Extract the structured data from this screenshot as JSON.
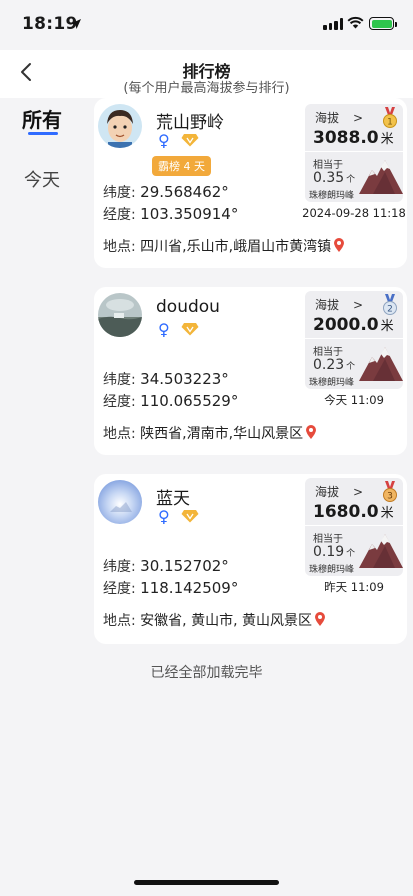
{
  "status_bar": {
    "time": "18:19"
  },
  "nav": {
    "title": "排行榜",
    "subtitle": "(每个用户最高海拔参与排行)"
  },
  "tabs": {
    "all": "所有",
    "today": "今天"
  },
  "labels": {
    "lat": "纬度:",
    "lng": "经度:",
    "place": "地点:",
    "altitude": "海拔",
    "equivalent": "相当于",
    "everest": "珠穆朗玛峰",
    "meter_unit": "米",
    "count_unit": "个"
  },
  "entries": [
    {
      "rank": "1",
      "name": "荒山野岭",
      "gender": "♀",
      "badge": "霸榜 4 天",
      "lat": "29.568462°",
      "lng": "103.350914°",
      "place": "四川省,乐山市,峨眉山市黄湾镇",
      "altitude": "3088.0",
      "everest_ratio": "0.35",
      "time": "2024-09-28 11:18",
      "medal_color": "#e8b43a"
    },
    {
      "rank": "2",
      "name": "doudou",
      "gender": "♀",
      "lat": "34.503223°",
      "lng": "110.065529°",
      "place": "陕西省,渭南市,华山风景区",
      "altitude": "2000.0",
      "everest_ratio": "0.23",
      "time": "今天 11:09",
      "medal_color": "#9bb0c8"
    },
    {
      "rank": "3",
      "name": "蓝天",
      "gender": "♀",
      "lat": "30.152702°",
      "lng": "118.142509°",
      "place": "安徽省, 黄山市, 黄山风景区",
      "altitude": "1680.0",
      "everest_ratio": "0.19",
      "time": "昨天 11:09",
      "medal_color": "#d98c3a"
    }
  ],
  "footer": "已经全部加载完毕"
}
